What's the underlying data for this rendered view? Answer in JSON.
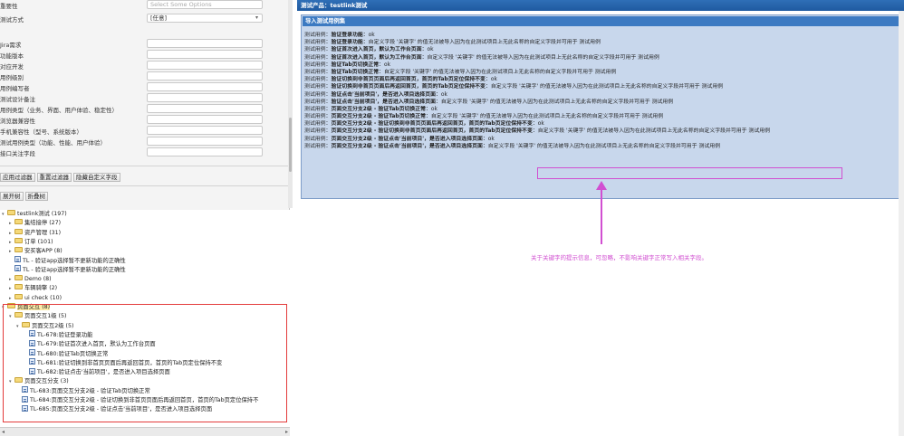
{
  "left": {
    "fields": [
      {
        "label": "重要性",
        "value": "Select Some Options",
        "kind": "placeholder"
      },
      {
        "label": "测试方式",
        "value": "[任意]",
        "kind": "select"
      },
      {
        "label": "",
        "value": "",
        "kind": "blank"
      },
      {
        "label": "Jira需求",
        "value": "",
        "kind": "input"
      },
      {
        "label": "功能版本",
        "value": "",
        "kind": "input"
      },
      {
        "label": "对应开发",
        "value": "",
        "kind": "input"
      },
      {
        "label": "用例级别",
        "value": "",
        "kind": "input"
      },
      {
        "label": "用例编写者",
        "value": "",
        "kind": "input"
      },
      {
        "label": "测试设计备注",
        "value": "",
        "kind": "input"
      },
      {
        "label": "用例类型（业务、界面、用户体验、稳定性）",
        "value": "",
        "kind": "input"
      },
      {
        "label": "浏览器兼容性",
        "value": "",
        "kind": "input"
      },
      {
        "label": "手机兼容性（型号、系统版本）",
        "value": "",
        "kind": "input"
      },
      {
        "label": "测试用例类型（功能、性能、用户体验）",
        "value": "",
        "kind": "input"
      },
      {
        "label": "接口关注字段",
        "value": "",
        "kind": "input"
      }
    ],
    "filter_buttons": [
      "应用过滤器",
      "重置过滤器",
      "隐藏自定义字段"
    ],
    "tree_buttons": [
      "展开树",
      "折叠树"
    ],
    "tree": [
      {
        "level": 0,
        "type": "folder",
        "toggle": "▾",
        "text": "testlink测试 (197)"
      },
      {
        "level": 1,
        "type": "folder",
        "toggle": "▸",
        "text": "集结接停 (27)"
      },
      {
        "level": 1,
        "type": "folder",
        "toggle": "▸",
        "text": "资产管理 (31)"
      },
      {
        "level": 1,
        "type": "folder",
        "toggle": "▸",
        "text": "订单 (101)"
      },
      {
        "level": 1,
        "type": "folder",
        "toggle": "▸",
        "text": "安买客APP (8)"
      },
      {
        "level": 1,
        "type": "case",
        "toggle": "",
        "text": "TL - 验证app选择暂不更新功能的正确性"
      },
      {
        "level": 1,
        "type": "case",
        "toggle": "",
        "text": "TL - 验证app选择暂不更新功能的正确性"
      },
      {
        "level": 1,
        "type": "folder",
        "toggle": "▸",
        "text": "Demo (8)"
      },
      {
        "level": 1,
        "type": "folder",
        "toggle": "▸",
        "text": "车辆骑擎 (2)"
      },
      {
        "level": 1,
        "type": "folder",
        "toggle": "▸",
        "text": "ui check (10)"
      },
      {
        "level": 0,
        "type": "folder",
        "toggle": "▾",
        "text": "页面交互 (8)",
        "selected": true
      },
      {
        "level": 1,
        "type": "folder",
        "toggle": "▾",
        "text": "页面交互1级 (5)"
      },
      {
        "level": 2,
        "type": "folder",
        "toggle": "▾",
        "text": "页面交互2级 (5)"
      },
      {
        "level": 3,
        "type": "case",
        "toggle": "",
        "text": "TL-678:验证登录功能"
      },
      {
        "level": 3,
        "type": "case",
        "toggle": "",
        "text": "TL-679:验证首次进入首页，默认为工作台页面"
      },
      {
        "level": 3,
        "type": "case",
        "toggle": "",
        "text": "TL-680:验证Tab页切换正常"
      },
      {
        "level": 3,
        "type": "case",
        "toggle": "",
        "text": "TL-681:验证切换到非首页页面后再返回首页，首页的Tab页定位保持不变"
      },
      {
        "level": 3,
        "type": "case",
        "toggle": "",
        "text": "TL-682:验证点击'当前项目'，是否进入项目选择页面"
      },
      {
        "level": 1,
        "type": "folder",
        "toggle": "▾",
        "text": "页面交互分支 (3)"
      },
      {
        "level": 2,
        "type": "case",
        "toggle": "",
        "text": "TL-683:页面交互分支2级 - 验证Tab页切换正常"
      },
      {
        "level": 2,
        "type": "case",
        "toggle": "",
        "text": "TL-684:页面交互分支2级 - 验证切换到非首页页面后再返回首页，首页的Tab页定位保持不"
      },
      {
        "level": 2,
        "type": "case",
        "toggle": "",
        "text": "TL-685:页面交互分支2级 - 验证点击'当前项目'，是否进入项目选择页面"
      }
    ]
  },
  "right": {
    "title": "测试产品：testlink测试",
    "panel_title": "导入测试用例集",
    "results": [
      {
        "pre": "测试用例：",
        "name": "验证登录功能",
        "post": "：ok"
      },
      {
        "pre": "测试用例：",
        "name": "验证登录功能",
        "post": "：自定义字段 '关键字' 的值无法被导入因为在此测试项目上无此名称的自定义字段并可用于 测试用例"
      },
      {
        "pre": "测试用例：",
        "name": "验证首次进入首页，默认为工作台页面",
        "post": "：ok"
      },
      {
        "pre": "测试用例：",
        "name": "验证首次进入首页，默认为工作台页面",
        "post": "：自定义字段 '关键字' 的值无法被导入因为在此测试项目上无此名称的自定义字段并可用于 测试用例"
      },
      {
        "pre": "测试用例：",
        "name": "验证Tab页切换正常",
        "post": "：ok"
      },
      {
        "pre": "测试用例：",
        "name": "验证Tab页切换正常",
        "post": "：自定义字段 '关键字' 的值无法被导入因为在此测试项目上无此名称的自定义字段并可用于 测试用例"
      },
      {
        "pre": "测试用例：",
        "name": "验证切换到非首页页面后再返回首页，首页的Tab页定位保持不变",
        "post": "：ok"
      },
      {
        "pre": "测试用例：",
        "name": "验证切换到非首页页面后再返回首页，首页的Tab页定位保持不变",
        "post": "：自定义字段 '关键字' 的值无法被导入因为在此测试项目上无此名称的自定义字段并可用于 测试用例"
      },
      {
        "pre": "测试用例：",
        "name": "验证点击'当前项目'，是否进入项目选择页面",
        "post": "：ok"
      },
      {
        "pre": "测试用例：",
        "name": "验证点击'当前项目'，是否进入项目选择页面",
        "post": "：自定义字段 '关键字' 的值无法被导入因为在此测试项目上无此名称的自定义字段并可用于 测试用例"
      },
      {
        "pre": "测试用例：",
        "name": "页面交互分支2级 - 验证Tab页切换正常",
        "post": "：ok"
      },
      {
        "pre": "测试用例：",
        "name": "页面交互分支2级 - 验证Tab页切换正常",
        "post": "：自定义字段 '关键字' 的值无法被导入因为在此测试项目上无此名称的自定义字段并可用于 测试用例"
      },
      {
        "pre": "测试用例：",
        "name": "页面交互分支2级 - 验证切换到非首页页面后再返回首页，首页的Tab页定位保持不变",
        "post": "：ok"
      },
      {
        "pre": "测试用例：",
        "name": "页面交互分支2级 - 验证切换到非首页页面后再返回首页，首页的Tab页定位保持不变",
        "post": "：自定义字段 '关键字' 的值无法被导入因为在此测试项目上无此名称的自定义字段并可用于 测试用例"
      },
      {
        "pre": "测试用例：",
        "name": "页面交互分支2级 - 验证点击'当前项目'，是否进入项目选择页面",
        "post": "：ok"
      },
      {
        "pre": "测试用例：",
        "name": "页面交互分支2级 - 验证点击'当前项目'，是否进入项目选择页面",
        "post": "：自定义字段 '关键字' 的值无法被导入因为在此测试项目上无此名称的自定义字段并可用于 测试用例"
      }
    ],
    "annotation": "关于关键字的提示信息，可忽略，不影响关键字正常写入相关字段。"
  },
  "colors": {
    "annotation": "#d14fd1",
    "highlight_box": "#e33b3b",
    "titlebar": "#2f6fb7"
  }
}
